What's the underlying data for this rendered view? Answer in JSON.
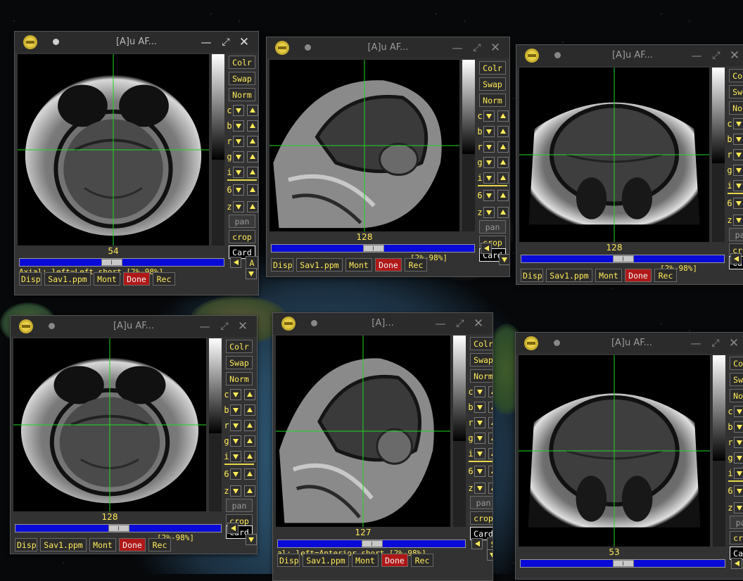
{
  "windows": [
    {
      "title": "[A]u AF...",
      "orient_badge": "AXIAL",
      "slice": "54",
      "slider_pos": 0.45,
      "status": "Axial: left=Left short [2%-98%]",
      "ctrl": {
        "btn": "A"
      }
    },
    {
      "title": "[A]u AF...",
      "orient_badge": "SAGITTAL",
      "slice": "128",
      "slider_pos": 0.5,
      "status": "[2%-98%]",
      "ctrl": null
    },
    {
      "title": "[A]u AF...",
      "orient_badge": "CORONAL",
      "slice": "128",
      "slider_pos": 0.5,
      "status": "[2%-98%]",
      "ctrl": null
    },
    {
      "title": "[A]u AF...",
      "orient_badge": "AXIAL",
      "slice": "128",
      "slider_pos": 0.5,
      "status": "[2%-98%]",
      "ctrl": null
    },
    {
      "title": "[A]...",
      "orient_badge": "SAGITTAL",
      "slice": "127",
      "slider_pos": 0.5,
      "status": "al: left=Anterior short [2%-98%]",
      "ctrl": {
        "btn": "S"
      }
    },
    {
      "title": "[A]u AF...",
      "orient_badge": "CORONAL",
      "slice": "53",
      "slider_pos": 0.5,
      "status": "",
      "ctrl": null
    }
  ],
  "side_buttons": {
    "colr": "Colr",
    "swap": "Swap",
    "norm": "Norm",
    "pan": "pan",
    "crop": "crop",
    "card": "Card"
  },
  "row_labels": [
    "c",
    "b",
    "r",
    "g",
    "i",
    "6",
    "z"
  ],
  "bottom_buttons": {
    "disp": "Disp",
    "sav": "Sav1.ppm",
    "mont": "Mont",
    "done": "Done",
    "rec": "Rec"
  },
  "colors": {
    "crosshair": "#22d822",
    "button_text": "#ffea5a",
    "done_bg": "#b01818",
    "slider": "#0a0ad8"
  }
}
